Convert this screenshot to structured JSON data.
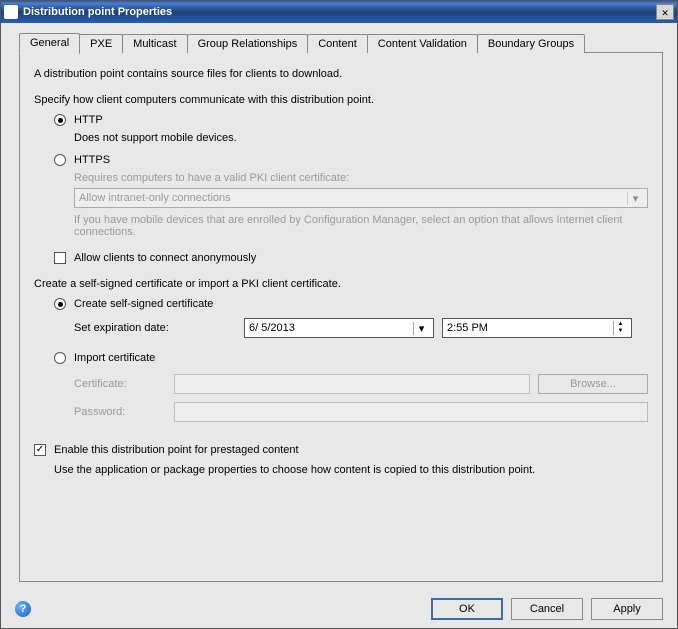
{
  "window": {
    "title": "Distribution point Properties"
  },
  "tabs": [
    "General",
    "PXE",
    "Multicast",
    "Group Relationships",
    "Content",
    "Content Validation",
    "Boundary Groups"
  ],
  "general": {
    "intro": "A distribution point contains source files for clients to download.",
    "specify": "Specify how client computers communicate with this distribution point.",
    "http_label": "HTTP",
    "http_note": "Does not support mobile devices.",
    "https_label": "HTTPS",
    "https_note": "Requires computers to have a valid PKI client certificate:",
    "https_combo": "Allow intranet-only connections",
    "https_hint": "If you have mobile devices that are enrolled by Configuration Manager, select an option that allows Internet client connections.",
    "anon_label": "Allow clients to connect anonymously",
    "cert_intro": "Create a self-signed certificate or import a PKI client certificate.",
    "create_self_label": "Create self-signed certificate",
    "exp_label": "Set expiration date:",
    "exp_date": "6/  5/2013",
    "exp_time": "2:55 PM",
    "import_label": "Import certificate",
    "cert_field": "Certificate:",
    "pass_field": "Password:",
    "browse": "Browse...",
    "prestage_label": "Enable this distribution point for prestaged content",
    "prestage_note": "Use the application or package properties to choose how content is copied to this distribution point."
  },
  "buttons": {
    "ok": "OK",
    "cancel": "Cancel",
    "apply": "Apply"
  }
}
